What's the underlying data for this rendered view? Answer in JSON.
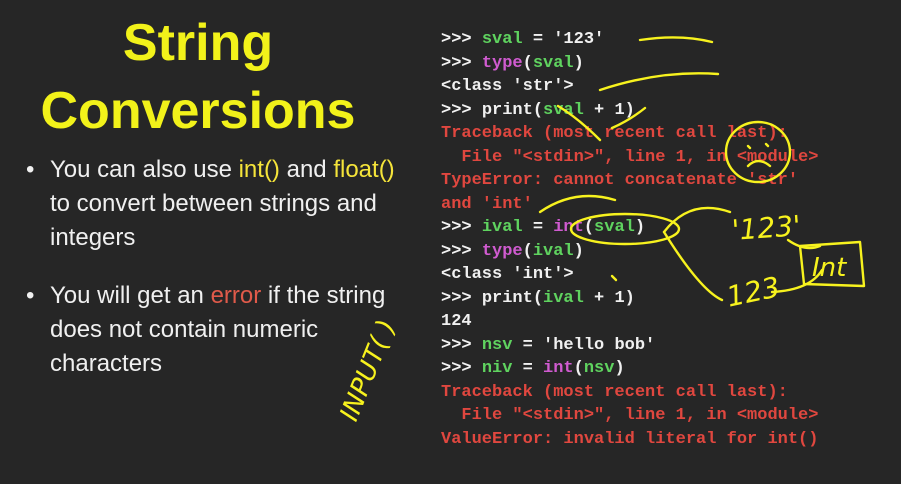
{
  "title": {
    "line1": "String",
    "line2": "Conversions"
  },
  "bullets": [
    {
      "pre": "You can also use ",
      "k1": "int()",
      "mid": " and ",
      "k2": "float()",
      "post": " to convert between strings and integers"
    },
    {
      "pre": "You will get an ",
      "err": "error",
      "post": " if the string does not contain numeric characters"
    }
  ],
  "code": [
    [
      {
        "c": "p",
        "t": ">>> "
      },
      {
        "c": "v",
        "t": "sval"
      },
      {
        "c": "t",
        "t": " = '123'"
      }
    ],
    [
      {
        "c": "p",
        "t": ">>> "
      },
      {
        "c": "f",
        "t": "type"
      },
      {
        "c": "t",
        "t": "("
      },
      {
        "c": "v",
        "t": "sval"
      },
      {
        "c": "t",
        "t": ")"
      }
    ],
    [
      {
        "c": "t",
        "t": "<class 'str'>"
      }
    ],
    [
      {
        "c": "p",
        "t": ">>> "
      },
      {
        "c": "t",
        "t": "print("
      },
      {
        "c": "v",
        "t": "sval"
      },
      {
        "c": "t",
        "t": " + 1)"
      }
    ],
    [
      {
        "c": "e",
        "t": "Traceback (most recent call last):"
      }
    ],
    [
      {
        "c": "e",
        "t": "  File \"<stdin>\", line 1, in <module>"
      }
    ],
    [
      {
        "c": "e",
        "t": "TypeError: cannot concatenate 'str'"
      }
    ],
    [
      {
        "c": "e",
        "t": "and 'int'"
      }
    ],
    [
      {
        "c": "p",
        "t": ">>> "
      },
      {
        "c": "v",
        "t": "ival"
      },
      {
        "c": "t",
        "t": " = "
      },
      {
        "c": "f",
        "t": "int"
      },
      {
        "c": "t",
        "t": "("
      },
      {
        "c": "v",
        "t": "sval"
      },
      {
        "c": "t",
        "t": ")"
      }
    ],
    [
      {
        "c": "p",
        "t": ">>> "
      },
      {
        "c": "f",
        "t": "type"
      },
      {
        "c": "t",
        "t": "("
      },
      {
        "c": "v",
        "t": "ival"
      },
      {
        "c": "t",
        "t": ")"
      }
    ],
    [
      {
        "c": "t",
        "t": "<class 'int'>"
      }
    ],
    [
      {
        "c": "p",
        "t": ">>> "
      },
      {
        "c": "t",
        "t": "print("
      },
      {
        "c": "v",
        "t": "ival"
      },
      {
        "c": "t",
        "t": " + 1)"
      }
    ],
    [
      {
        "c": "t",
        "t": "124"
      }
    ],
    [
      {
        "c": "p",
        "t": ">>> "
      },
      {
        "c": "v",
        "t": "nsv"
      },
      {
        "c": "t",
        "t": " = 'hello bob'"
      }
    ],
    [
      {
        "c": "p",
        "t": ">>> "
      },
      {
        "c": "v",
        "t": "niv"
      },
      {
        "c": "t",
        "t": " = "
      },
      {
        "c": "f",
        "t": "int"
      },
      {
        "c": "t",
        "t": "("
      },
      {
        "c": "v",
        "t": "nsv"
      },
      {
        "c": "t",
        "t": ")"
      }
    ],
    [
      {
        "c": "e",
        "t": "Traceback (most recent call last):"
      }
    ],
    [
      {
        "c": "e",
        "t": "  File \"<stdin>\", line 1, in <module>"
      }
    ],
    [
      {
        "c": "e",
        "t": "ValueError: invalid literal for int()"
      }
    ]
  ],
  "annotations": {
    "input": "INPUT( )",
    "quoted": "'123'",
    "plain": "123",
    "int": "Int"
  },
  "colors": {
    "background": "#262626",
    "title": "#f2f21a",
    "keyword": "#f5e43a",
    "error": "#e05a4a",
    "variable": "#5fd35f",
    "function": "#d05bd0",
    "ink": "#f7f21e"
  }
}
